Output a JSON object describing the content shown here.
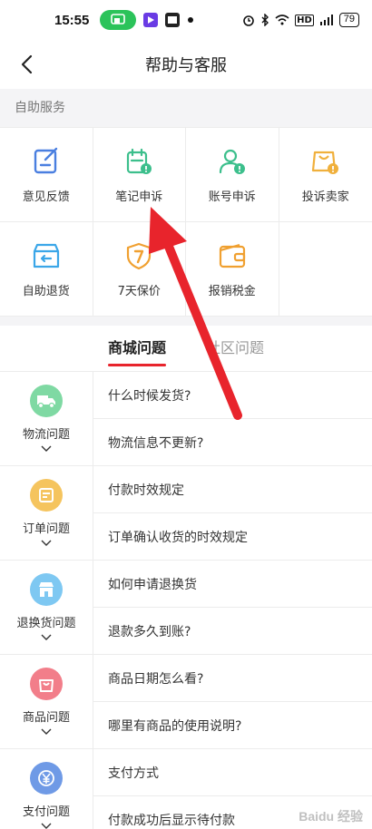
{
  "status_bar": {
    "time": "15:55",
    "battery": "79",
    "hd_badge": "HD"
  },
  "header": {
    "title": "帮助与客服"
  },
  "self_service": {
    "section_title": "自助服务",
    "items": [
      {
        "label": "意见反馈",
        "icon": "feedback-icon",
        "color": "#4a7fe0"
      },
      {
        "label": "笔记申诉",
        "icon": "note-appeal-icon",
        "color": "#3cbf8c"
      },
      {
        "label": "账号申诉",
        "icon": "account-appeal-icon",
        "color": "#3cbf8c"
      },
      {
        "label": "投诉卖家",
        "icon": "complain-seller-icon",
        "color": "#f0b03c"
      },
      {
        "label": "自助退货",
        "icon": "self-return-icon",
        "color": "#3aa6e8"
      },
      {
        "label": "7天保价",
        "icon": "price-protect-icon",
        "color": "#f0a030"
      },
      {
        "label": "报销税金",
        "icon": "tax-refund-icon",
        "color": "#f0a030"
      }
    ]
  },
  "tabs": {
    "active": "商城问题",
    "inactive": "社区问题"
  },
  "faq": [
    {
      "category": "物流问题",
      "icon": "truck-icon",
      "color": "#7fd9a3",
      "questions": [
        "什么时候发货?",
        "物流信息不更新?"
      ]
    },
    {
      "category": "订单问题",
      "icon": "order-icon",
      "color": "#f5c45e",
      "questions": [
        "付款时效规定",
        "订单确认收货的时效规定"
      ]
    },
    {
      "category": "退换货问题",
      "icon": "shop-icon",
      "color": "#7ec8f2",
      "questions": [
        "如何申请退换货",
        "退款多久到账?"
      ]
    },
    {
      "category": "商品问题",
      "icon": "bag-icon",
      "color": "#f27e8a",
      "questions": [
        "商品日期怎么看?",
        "哪里有商品的使用说明?"
      ]
    },
    {
      "category": "支付问题",
      "icon": "yuan-icon",
      "color": "#6f9ae6",
      "questions": [
        "支付方式",
        "付款成功后显示待付款"
      ]
    }
  ],
  "watermark": "Baidu 经验"
}
